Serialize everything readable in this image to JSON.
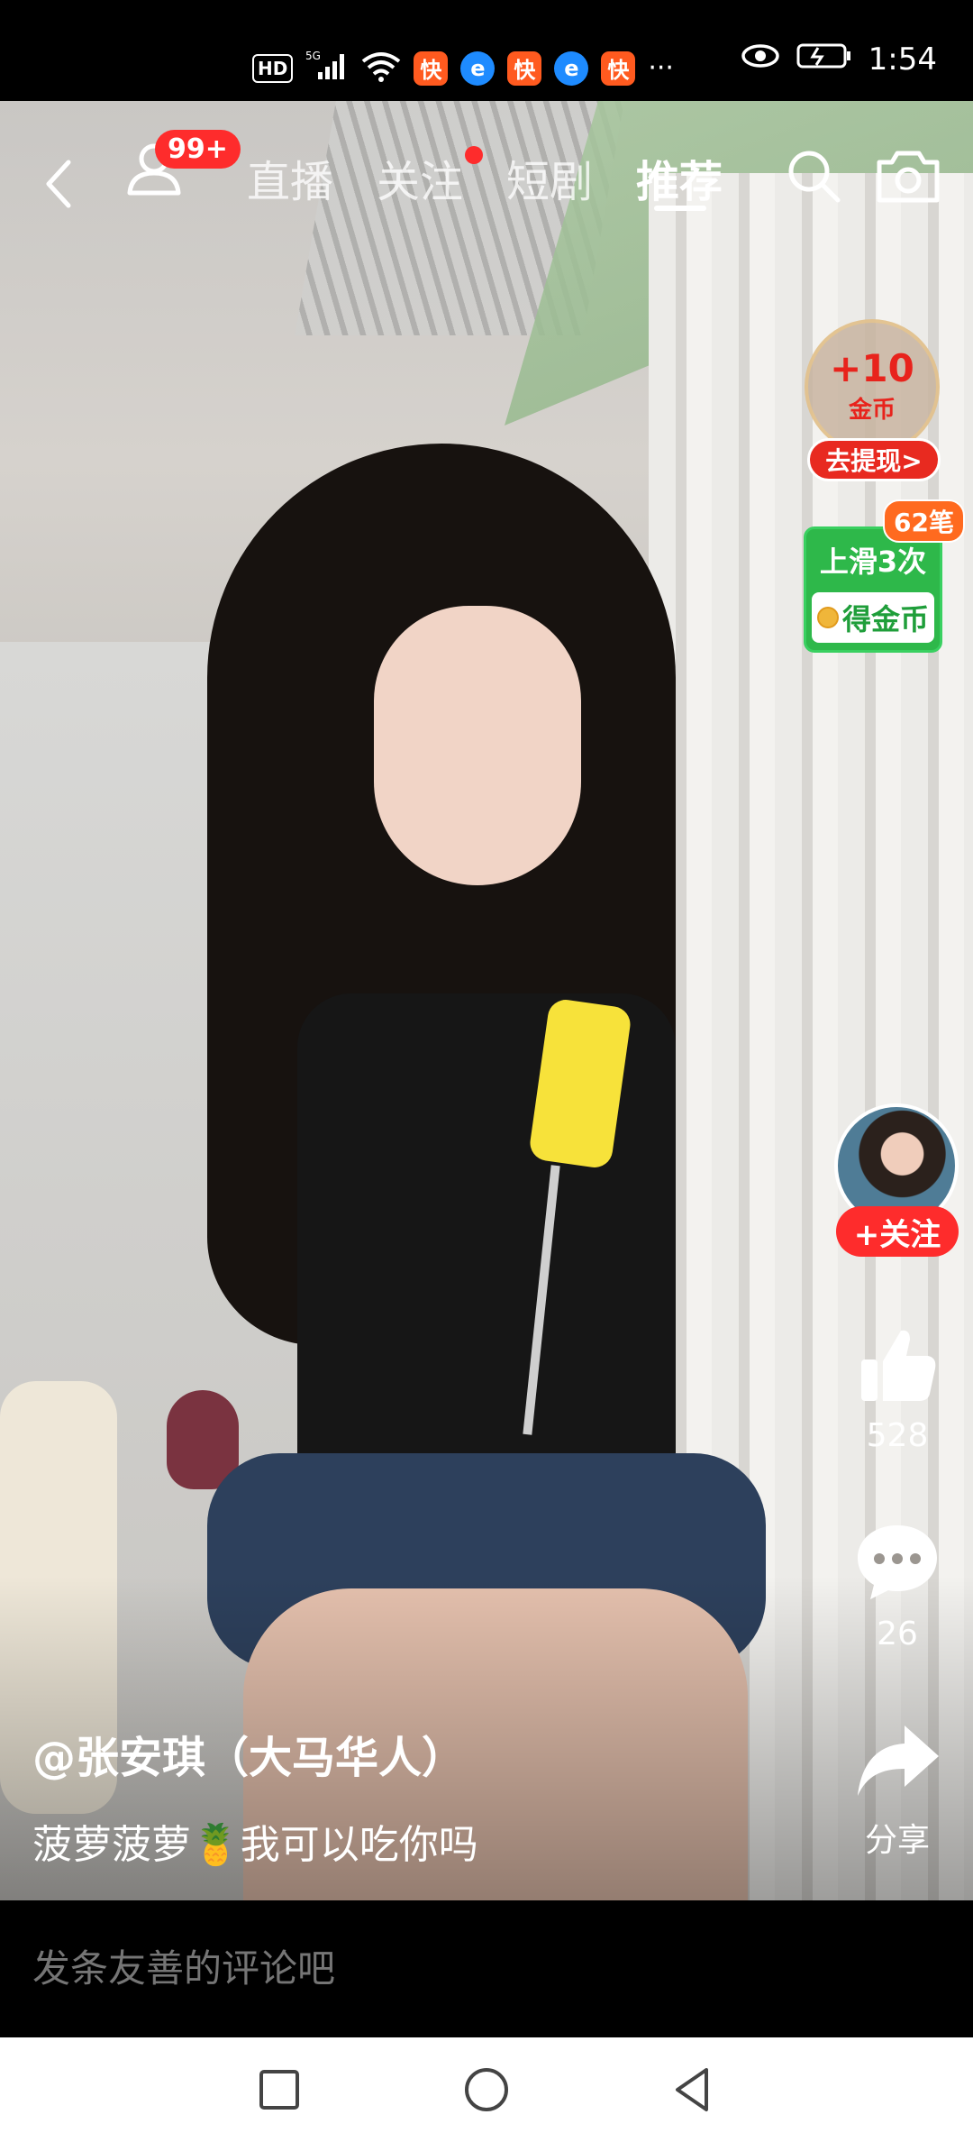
{
  "status_bar": {
    "hd": "HD",
    "network": "5G",
    "app_icon_1": "快",
    "app_icon_2": "e",
    "app_icon_3": "快",
    "app_icon_4": "e",
    "app_icon_5": "快",
    "more": "···",
    "time": "1:54"
  },
  "top_nav": {
    "badge": "99+",
    "tabs": [
      {
        "label": "直播"
      },
      {
        "label": "关注"
      },
      {
        "label": "短剧"
      },
      {
        "label": "推荐"
      }
    ]
  },
  "coin_widget": {
    "amount": "+10",
    "unit": "金币",
    "withdraw_label": "去提现>"
  },
  "task_card": {
    "badge": "62笔",
    "title": "上滑3次",
    "reward": "得金币"
  },
  "actions": {
    "follow_label": "+关注",
    "likes": "528",
    "comments": "26",
    "share_label": "分享"
  },
  "post": {
    "author": "@张安琪（大马华人）",
    "caption": "菠萝菠萝🍍我可以吃你吗"
  },
  "comment": {
    "placeholder": "发条友善的评论吧"
  }
}
